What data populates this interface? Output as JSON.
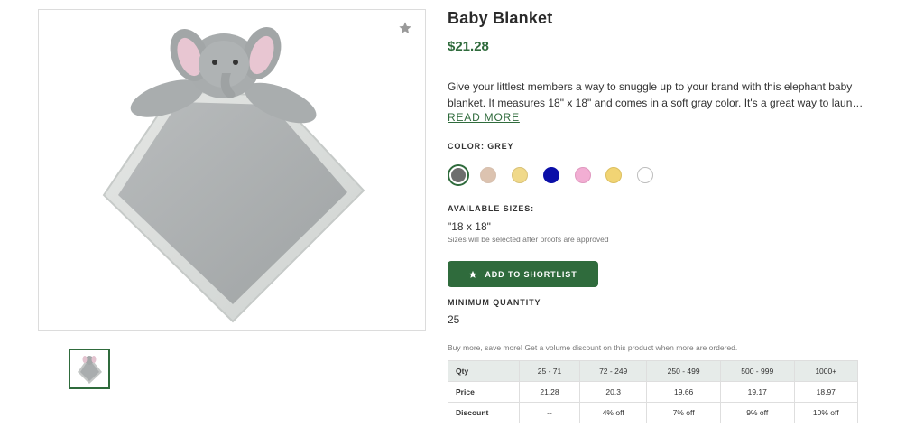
{
  "product": {
    "title": "Baby Blanket",
    "price": "$21.28",
    "description_line1": "Give your littlest members a way to snuggle up to your brand with this elephant baby",
    "description_line2": "blanket. It measures 18\" x 18\" and comes in a soft gray color. It's a great way to laun…",
    "read_more": "READ MORE"
  },
  "color": {
    "label": "COLOR: GREY",
    "swatches": [
      {
        "name": "grey",
        "hex": "#6e6e6e",
        "selected": true
      },
      {
        "name": "tan",
        "hex": "#dcc3b0",
        "selected": false
      },
      {
        "name": "yellow",
        "hex": "#f0d98a",
        "selected": false
      },
      {
        "name": "navy",
        "hex": "#0b0fa8",
        "selected": false
      },
      {
        "name": "pink",
        "hex": "#f2aed3",
        "selected": false
      },
      {
        "name": "gold",
        "hex": "#f1d474",
        "selected": false
      },
      {
        "name": "white",
        "hex": "#ffffff",
        "selected": false
      }
    ]
  },
  "sizes": {
    "label": "AVAILABLE SIZES:",
    "value": "\"18 x 18\"",
    "note": "Sizes will be selected after proofs are approved"
  },
  "shortlist_button": "ADD TO SHORTLIST",
  "minimum": {
    "label": "MINIMUM QUANTITY",
    "value": "25"
  },
  "volume": {
    "note": "Buy more, save more! Get a volume discount on this product when more are ordered.",
    "headers": [
      "Qty",
      "25 - 71",
      "72 - 249",
      "250 - 499",
      "500 - 999",
      "1000+"
    ],
    "rows": [
      [
        "Price",
        "21.28",
        "20.3",
        "19.66",
        "19.17",
        "18.97"
      ],
      [
        "Discount",
        "--",
        "4% off",
        "7% off",
        "9% off",
        "10% off"
      ]
    ]
  },
  "icons": {
    "favorite": "star-icon",
    "shortlist": "star-icon"
  },
  "theme": {
    "accent": "#2f6b3c"
  }
}
